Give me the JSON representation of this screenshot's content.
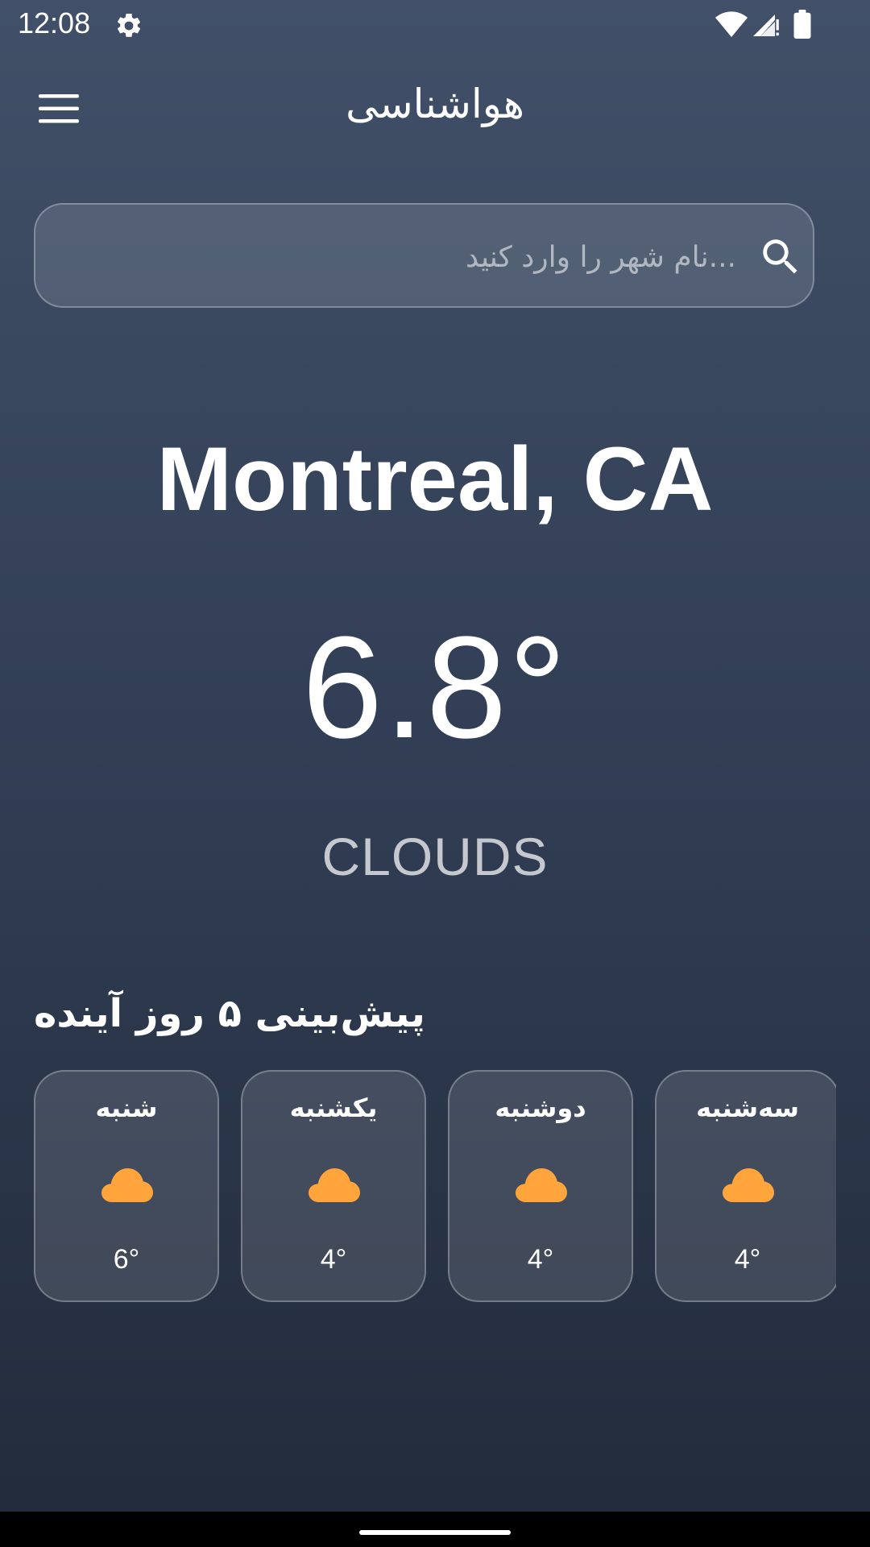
{
  "status_bar": {
    "time": "12:08",
    "icons": [
      "gear-icon",
      "wifi-icon",
      "signal-icon",
      "battery-icon"
    ]
  },
  "app_bar": {
    "title": "هواشناسی",
    "menu_icon": "menu-icon"
  },
  "search": {
    "placeholder": "...نام شهر را وارد کنید",
    "value": "",
    "icon": "search-icon"
  },
  "current": {
    "city": "Montreal, CA",
    "temperature": "6.8°",
    "condition": "CLOUDS"
  },
  "forecast": {
    "title": "پیش‌بینی ۵ روز آینده",
    "days": [
      {
        "day": "شنبه",
        "icon": "cloud-icon",
        "temp": "6°"
      },
      {
        "day": "یکشنبه",
        "icon": "cloud-icon",
        "temp": "4°"
      },
      {
        "day": "دوشنبه",
        "icon": "cloud-icon",
        "temp": "4°"
      },
      {
        "day": "سه‌شنبه",
        "icon": "cloud-icon",
        "temp": "4°"
      }
    ]
  },
  "colors": {
    "background_top": "#415068",
    "background_bottom": "#222b3b",
    "cloud_icon": "#ffa53b",
    "text": "#ffffff"
  }
}
